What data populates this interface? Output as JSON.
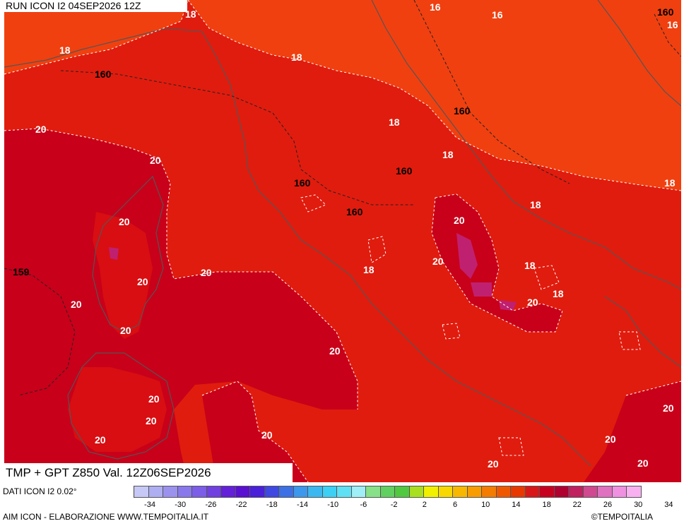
{
  "header": {
    "run_title": "RUN ICON I2 04SEP2026 12Z",
    "variable_title": "TMP + GPT Z850 Val. 12Z06SEP2026"
  },
  "footer": {
    "data_source": "DATI ICON I2 0.02°",
    "credit_left": "AIM ICON - ELABORAZIONE WWW.TEMPOITALIA.IT",
    "credit_right": "©TEMPOITALIA"
  },
  "legend": {
    "colors": [
      "#c6c8f5",
      "#aeaef2",
      "#9b92ee",
      "#8878ec",
      "#7b5de8",
      "#7040e0",
      "#6420d8",
      "#5a10d0",
      "#4a20d8",
      "#3f48e0",
      "#3c70e4",
      "#3c98ec",
      "#3cb8f0",
      "#3cd0f4",
      "#60e0f4",
      "#a0eef6",
      "#88e088",
      "#60d060",
      "#50c840",
      "#a8e020",
      "#f0f000",
      "#f8d800",
      "#f8b800",
      "#f89c00",
      "#f47c00",
      "#f05800",
      "#e83800",
      "#d81818",
      "#c80020",
      "#b00030",
      "#c02060",
      "#d04890",
      "#e070c0",
      "#f090e0",
      "#f8b0f0"
    ],
    "ticks": [
      "-34",
      "-30",
      "-26",
      "-22",
      "-18",
      "-14",
      "-10",
      "-6",
      "-2",
      "2",
      "6",
      "10",
      "14",
      "18",
      "22",
      "26",
      "30",
      "34"
    ]
  },
  "map": {
    "temperature_labels": [
      "16",
      "16",
      "160",
      "16",
      "18",
      "18",
      "160",
      "20",
      "18",
      "160",
      "18",
      "20",
      "160",
      "18",
      "160",
      "18",
      "20",
      "20",
      "18",
      "20",
      "159",
      "20",
      "18",
      "20",
      "20",
      "18",
      "20",
      "20",
      "20",
      "20",
      "20",
      "20",
      "20",
      "20",
      "20",
      "20"
    ],
    "colors": {
      "t16": "#f04010",
      "t18": "#e01c0e",
      "t20": "#c8001a",
      "t22": "#b00030",
      "t24": "#c02070",
      "contour": "#ffffff",
      "coast": "#555555",
      "gpt": "#222222"
    }
  }
}
